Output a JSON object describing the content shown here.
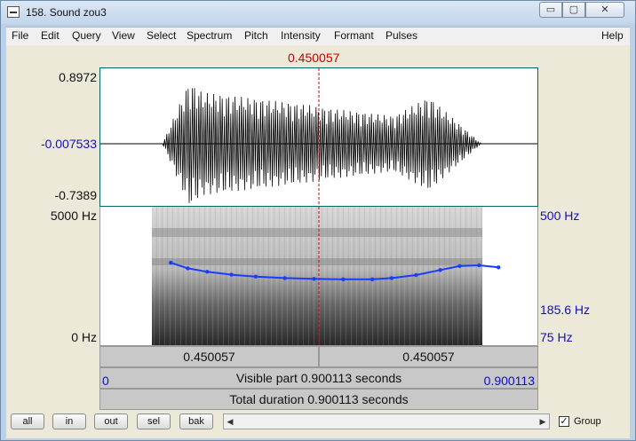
{
  "window": {
    "title": "158. Sound zou3",
    "minimize_glyph": "▭",
    "maximize_glyph": "▢",
    "close_glyph": "✕"
  },
  "menu": [
    "File",
    "Edit",
    "Query",
    "View",
    "Select",
    "Spectrum",
    "Pitch",
    "Intensity",
    "Formant",
    "Pulses",
    "Help"
  ],
  "cursor": {
    "time": "0.450057"
  },
  "waveform": {
    "max_label": "0.8972",
    "zero_label": "-0.007533",
    "min_label": "-0.7389"
  },
  "spectrogram": {
    "top_freq_label": "5000 Hz",
    "bottom_freq_label": "0 Hz",
    "pitch_top_label": "500 Hz",
    "pitch_value_label": "185.6 Hz",
    "pitch_bottom_label": "75 Hz"
  },
  "pitch_track": [
    {
      "t": 0.145,
      "hz": 232
    },
    {
      "t": 0.18,
      "hz": 215
    },
    {
      "t": 0.22,
      "hz": 205
    },
    {
      "t": 0.27,
      "hz": 197
    },
    {
      "t": 0.32,
      "hz": 192
    },
    {
      "t": 0.38,
      "hz": 188
    },
    {
      "t": 0.44,
      "hz": 186
    },
    {
      "t": 0.5,
      "hz": 185
    },
    {
      "t": 0.56,
      "hz": 185
    },
    {
      "t": 0.6,
      "hz": 188
    },
    {
      "t": 0.65,
      "hz": 196
    },
    {
      "t": 0.7,
      "hz": 210
    },
    {
      "t": 0.74,
      "hz": 222
    },
    {
      "t": 0.78,
      "hz": 224
    },
    {
      "t": 0.82,
      "hz": 218
    }
  ],
  "time_bars": {
    "left_segment": "0.450057",
    "right_segment": "0.450057",
    "visible_start": "0",
    "visible_text": "Visible part 0.900113 seconds",
    "visible_end": "0.900113",
    "total_text": "Total duration 0.900113 seconds"
  },
  "buttons": [
    "all",
    "in",
    "out",
    "sel",
    "bak"
  ],
  "scroll": {
    "left_arrow": "◀",
    "right_arrow": "▶"
  },
  "group": {
    "label": "Group",
    "checked": true,
    "check_glyph": "✓"
  }
}
